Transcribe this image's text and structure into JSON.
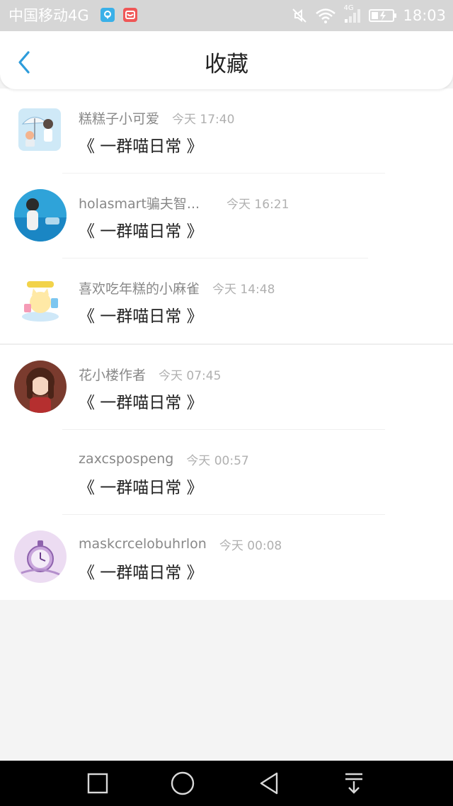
{
  "status_bar": {
    "carrier": "中国移动4G",
    "network_badge": "4G",
    "time": "18:03",
    "icons": [
      "location-icon",
      "mail-icon",
      "mute-icon",
      "wifi-icon",
      "signal-icon",
      "battery-icon"
    ]
  },
  "header": {
    "title": "收藏",
    "back_icon": "chevron-left-icon",
    "accent_color": "#2d9cdb"
  },
  "favorites": [
    {
      "username": "糕糕子小可爱",
      "time": "今天 17:40",
      "title": "《 一群喵日常 》",
      "avatar": "umbrella-illustration"
    },
    {
      "username": "holasmart骗夫智...",
      "time": "今天 16:21",
      "title": "《 一群喵日常 》",
      "avatar": "girl-by-sea-photo"
    },
    {
      "username": "喜欢吃年糕的小麻雀",
      "time": "今天 14:48",
      "title": "《 一群喵日常 》",
      "avatar": "cartoon-cat-sticker"
    },
    {
      "username": "花小楼作者",
      "time": "今天 07:45",
      "title": "《 一群喵日常 》",
      "avatar": "anime-girl"
    },
    {
      "username": "zaxcspospeng",
      "time": "今天 00:57",
      "title": "《 一群喵日常 》",
      "avatar": "none"
    },
    {
      "username": "maskcrcelobuhrlon",
      "time": "今天 00:08",
      "title": "《 一群喵日常 》",
      "avatar": "pocket-watch"
    }
  ],
  "nav_bar": {
    "buttons": [
      "recent-apps-icon",
      "home-icon",
      "back-icon",
      "notification-pull-icon"
    ]
  }
}
